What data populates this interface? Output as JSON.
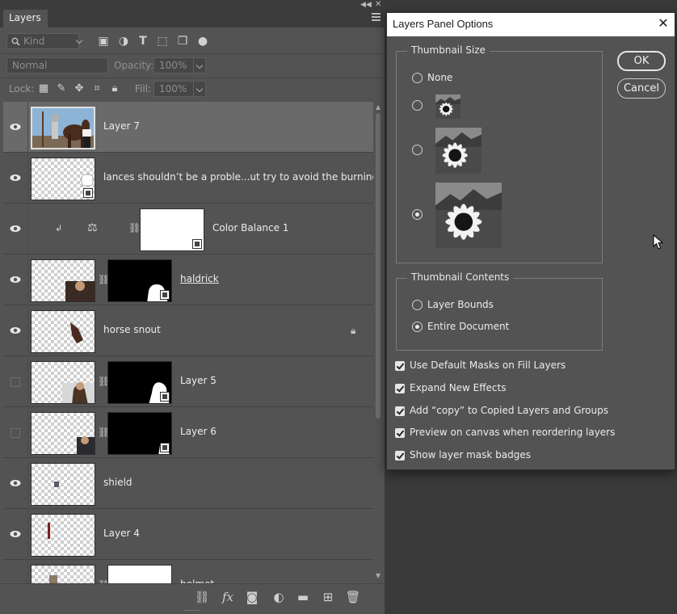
{
  "panel": {
    "tab_label": "Layers",
    "filter": {
      "kind_placeholder": "Kind"
    },
    "blend_mode": "Normal",
    "opacity_label": "Opacity:",
    "opacity_value": "100%",
    "lock_label": "Lock:",
    "fill_label": "Fill:",
    "fill_value": "100%"
  },
  "layers": [
    {
      "name": "Layer 7",
      "visible": true,
      "selected": true
    },
    {
      "name": "lances shouldn’t be a proble...ut try to avoid the burning",
      "visible": true
    },
    {
      "name": "Color Balance 1",
      "visible": true
    },
    {
      "name": "haldrick",
      "visible": true
    },
    {
      "name": "horse snout",
      "visible": true,
      "locked": true
    },
    {
      "name": "Layer 5",
      "visible": false
    },
    {
      "name": "Layer 6",
      "visible": false
    },
    {
      "name": "shield",
      "visible": true
    },
    {
      "name": "Layer 4",
      "visible": true
    },
    {
      "name": "helmet",
      "visible": true
    }
  ],
  "dialog": {
    "title": "Layers Panel Options",
    "thumbnail_size": {
      "label": "Thumbnail Size",
      "options": [
        "None",
        "Small",
        "Medium",
        "Large"
      ],
      "selected": "Large"
    },
    "thumbnail_contents": {
      "label": "Thumbnail Contents",
      "options": [
        "Layer Bounds",
        "Entire Document"
      ],
      "selected": "Entire Document"
    },
    "checkboxes": [
      {
        "label": "Use Default Masks on Fill Layers",
        "checked": true
      },
      {
        "label": "Expand New Effects",
        "checked": true
      },
      {
        "label": "Add “copy” to Copied Layers and Groups",
        "checked": true
      },
      {
        "label": "Preview on canvas when reordering layers",
        "checked": true
      },
      {
        "label": "Show layer mask badges",
        "checked": true
      }
    ],
    "ok_label": "OK",
    "cancel_label": "Cancel"
  },
  "colors": {
    "panel_bg": "#535353",
    "selected_row": "#6a6a6a",
    "dialog_titlebar": "#ffffff"
  }
}
